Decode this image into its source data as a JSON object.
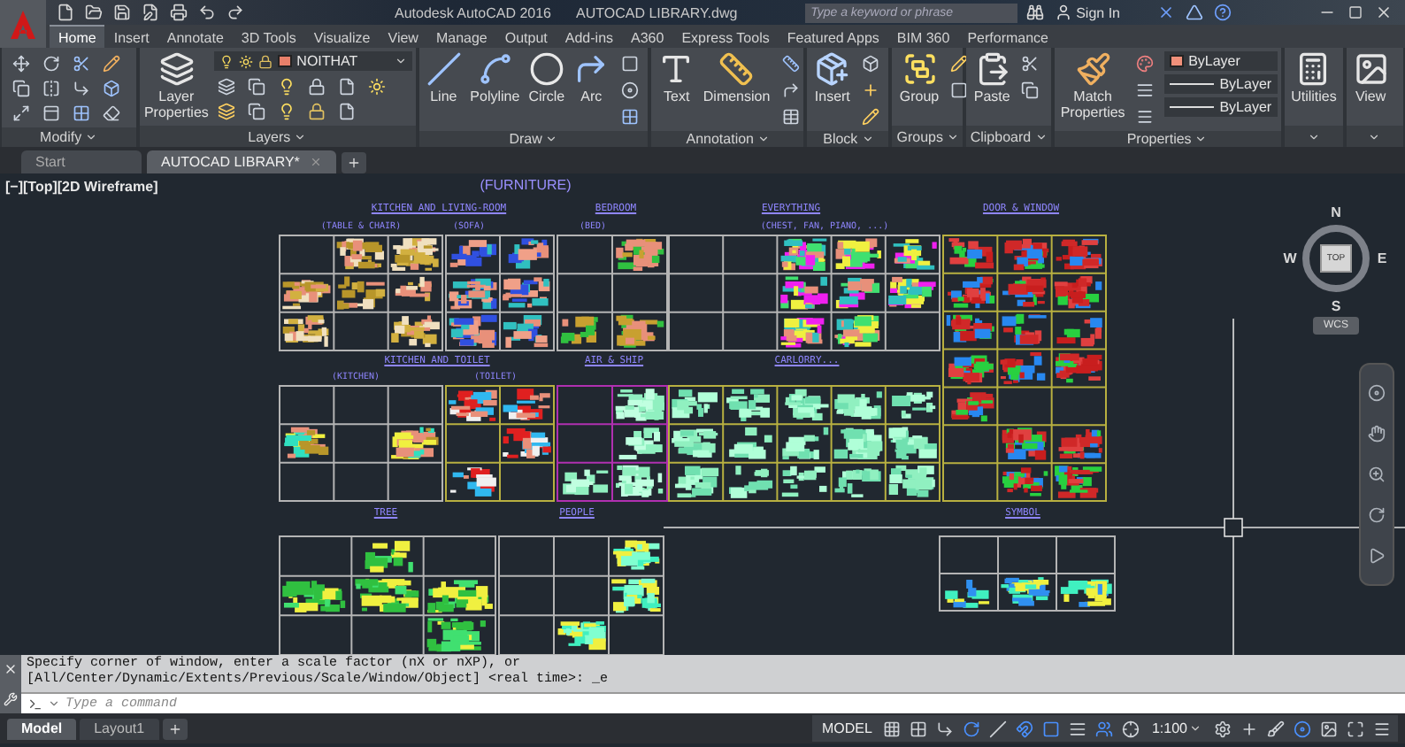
{
  "title_bar": {
    "app_title": "Autodesk AutoCAD 2016",
    "file_name": "AUTOCAD LIBRARY.dwg",
    "search": {
      "placeholder": "Type a keyword or phrase"
    },
    "sign_in": "Sign In"
  },
  "ribbon_tabs": [
    {
      "label": "Home",
      "selected": true
    },
    {
      "label": "Insert",
      "selected": false
    },
    {
      "label": "Annotate",
      "selected": false
    },
    {
      "label": "3D Tools",
      "selected": false
    },
    {
      "label": "Visualize",
      "selected": false
    },
    {
      "label": "View",
      "selected": false
    },
    {
      "label": "Manage",
      "selected": false
    },
    {
      "label": "Output",
      "selected": false
    },
    {
      "label": "Add-ins",
      "selected": false
    },
    {
      "label": "A360",
      "selected": false
    },
    {
      "label": "Express Tools",
      "selected": false
    },
    {
      "label": "Featured Apps",
      "selected": false
    },
    {
      "label": "BIM 360",
      "selected": false
    },
    {
      "label": "Performance",
      "selected": false
    }
  ],
  "ribbon_panels": [
    {
      "kind": "modify",
      "title": "Modify"
    },
    {
      "kind": "layers",
      "title": "Layers",
      "buttons": [
        "Layer Properties"
      ],
      "layer": "NOITHAT"
    },
    {
      "kind": "draw",
      "title": "Draw",
      "buttons": [
        "Line",
        "Polyline",
        "Circle",
        "Arc"
      ]
    },
    {
      "kind": "annotation",
      "title": "Annotation",
      "buttons": [
        "Text",
        "Dimension"
      ]
    },
    {
      "kind": "block",
      "title": "Block",
      "buttons": [
        "Insert"
      ]
    },
    {
      "kind": "groups",
      "title": "Groups",
      "buttons": [
        "Group"
      ]
    },
    {
      "kind": "clipboard",
      "title": "Clipboard",
      "buttons": [
        "Paste"
      ]
    },
    {
      "kind": "properties",
      "title": "Properties",
      "buttons": [
        "Match Properties"
      ],
      "dropdowns": [
        "ByLayer",
        "ByLayer",
        "ByLayer"
      ]
    },
    {
      "kind": "utilities",
      "buttons": [
        "Utilities"
      ]
    },
    {
      "kind": "view",
      "buttons": [
        "View"
      ]
    }
  ],
  "file_tabs": [
    {
      "label": "Start",
      "selected": false
    },
    {
      "label": "AUTOCAD LIBRARY*",
      "selected": true
    }
  ],
  "viewport_label": "[−][Top][2D Wireframe]",
  "drawing": {
    "title": "(FURNITURE)",
    "labels": [
      {
        "text": "KITCHEN AND LIVING-ROOM",
        "kind": "heading"
      },
      {
        "text": "BEDROOM",
        "kind": "heading"
      },
      {
        "text": "EVERYTHING",
        "kind": "heading"
      },
      {
        "text": "DOOR & WINDOW",
        "kind": "heading"
      },
      {
        "text": "(TABLE & CHAIR)",
        "kind": "note"
      },
      {
        "text": "(SOFA)",
        "kind": "note"
      },
      {
        "text": "(BED)",
        "kind": "note"
      },
      {
        "text": "(CHEST, FAN, PIANO, ...)",
        "kind": "note"
      },
      {
        "text": "KITCHEN AND TOILET",
        "kind": "heading"
      },
      {
        "text": "AIR & SHIP",
        "kind": "heading"
      },
      {
        "text": "CARLORRY...",
        "kind": "heading"
      },
      {
        "text": "(KITCHEN)",
        "kind": "note"
      },
      {
        "text": "(TOILET)",
        "kind": "note"
      },
      {
        "text": "TREE",
        "kind": "heading"
      },
      {
        "text": "PEOPLE",
        "kind": "heading"
      },
      {
        "text": "SYMBOL",
        "kind": "heading"
      }
    ]
  },
  "view_cube": {
    "face": "TOP",
    "directions": [
      "N",
      "E",
      "S",
      "W"
    ],
    "coordinate_system": "WCS"
  },
  "command_line": {
    "history": [
      "Specify corner of window, enter a scale factor (nX or nXP), or",
      "[All/Center/Dynamic/Extents/Previous/Scale/Window/Object] <real time>: _e"
    ],
    "placeholder": "Type a command"
  },
  "layout_tabs": [
    {
      "label": "Model",
      "selected": true
    },
    {
      "label": "Layout1",
      "selected": false
    }
  ],
  "status_bar": {
    "space": "MODEL",
    "scale": "1:100"
  }
}
